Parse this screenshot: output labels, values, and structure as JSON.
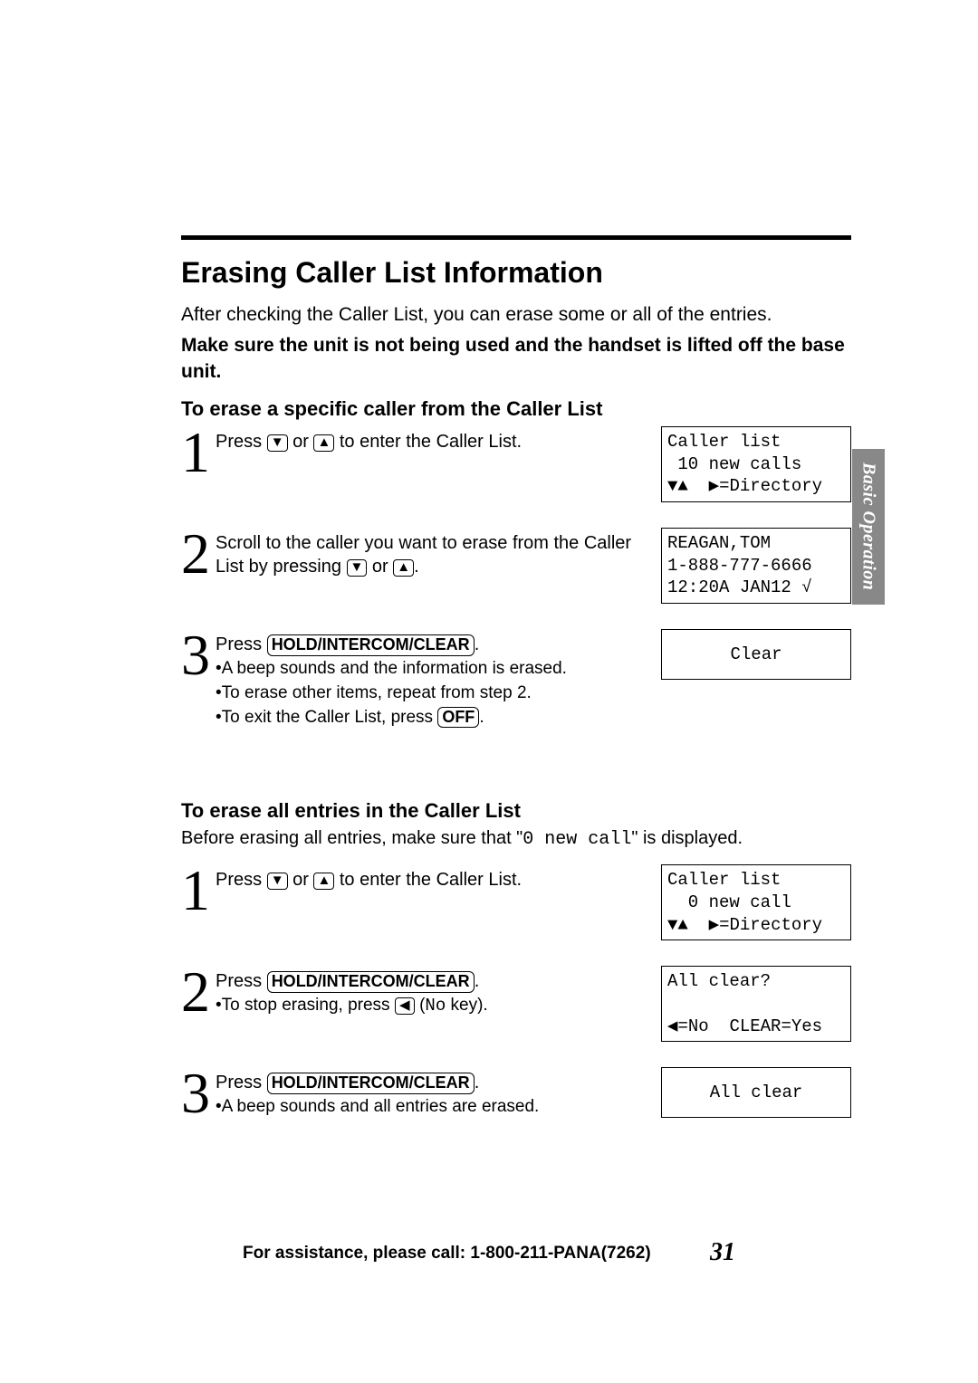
{
  "heading": "Erasing Caller List Information",
  "intro_plain": "After checking the Caller List, you can erase some or all of the entries.",
  "intro_bold": "Make sure the unit is not being used and the handset is lifted off the base unit.",
  "sectionA": {
    "title": "To erase a specific caller from the Caller List",
    "step1": {
      "num": "1",
      "text_a": "Press ",
      "text_b": " or ",
      "text_c": " to enter the Caller List.",
      "lcd_l1": "Caller list",
      "lcd_l2": " 10 new calls",
      "lcd_l3_a": "▼▲  ",
      "lcd_l3_b": "▶",
      "lcd_l3_c": "=Directory"
    },
    "step2": {
      "num": "2",
      "text_a": "Scroll to the caller you want to erase from the Caller List by pressing ",
      "text_b": " or ",
      "text_c": ".",
      "lcd_l1": "REAGAN,TOM",
      "lcd_l2": "1-888-777-6666",
      "lcd_l3": "12:20A JAN12 √"
    },
    "step3": {
      "num": "3",
      "text_a": "Press ",
      "text_b": ".",
      "bullet1": "•A beep sounds and the information is erased.",
      "bullet2": "•To erase other items, repeat from step 2.",
      "bullet3a": "•To exit the Caller List, press ",
      "bullet3b": ".",
      "lcd": "Clear"
    }
  },
  "sectionB": {
    "title": "To erase all entries in the Caller List",
    "before_a": "Before erasing all entries, make sure that \"",
    "before_mono": "0 new call",
    "before_b": "\" is displayed.",
    "step1": {
      "num": "1",
      "text_a": "Press ",
      "text_b": " or ",
      "text_c": " to enter the Caller List.",
      "lcd_l1": "Caller list",
      "lcd_l2": "  0 new call",
      "lcd_l3_a": "▼▲  ",
      "lcd_l3_b": "▶",
      "lcd_l3_c": "=Directory"
    },
    "step2": {
      "num": "2",
      "text_a": "Press ",
      "text_b": ".",
      "bullet1a": "•To stop erasing, press ",
      "bullet1b": " (",
      "bullet1_mono": "No",
      "bullet1c": " key).",
      "lcd_l1": "All clear?",
      "lcd_l2": "",
      "lcd_l3": "◀=No  CLEAR=Yes"
    },
    "step3": {
      "num": "3",
      "text_a": "Press ",
      "text_b": ".",
      "bullet1": "•A beep sounds and all entries are erased.",
      "lcd": "All clear"
    }
  },
  "keys": {
    "down": "▼",
    "up": "▲",
    "left": "◀",
    "hold": "HOLD/INTERCOM/CLEAR",
    "off": "OFF"
  },
  "side_tab": "Basic Operation",
  "footer_text": "For assistance, please call: 1-800-211-PANA(7262)",
  "page_number": "31"
}
